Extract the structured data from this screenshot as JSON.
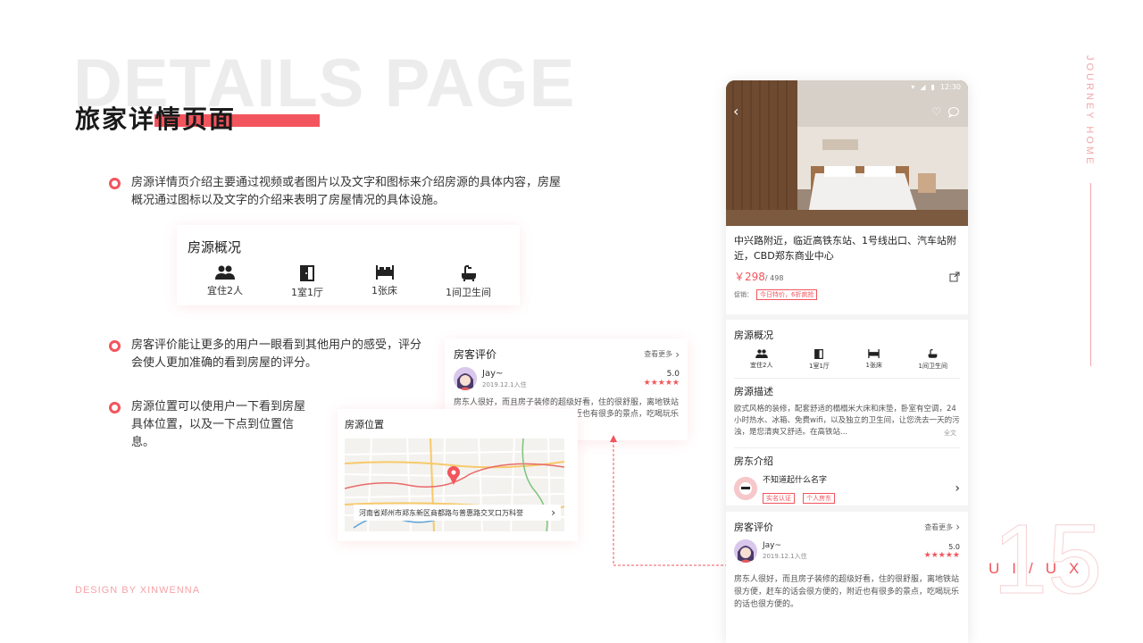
{
  "background_title": "DETAILS PAGE",
  "title": "旅家详情页面",
  "bullets": [
    {
      "text": "房源详情页介绍主要通过视频或者图片以及文字和图标来介绍房源的具体内容，房屋概况通过图标以及文字的介绍来表明了房屋情况的具体设施。"
    },
    {
      "text": "房客评价能让更多的用户一眼看到其他用户的感受，评分会使人更加准确的看到房屋的评分。"
    },
    {
      "text": "房源位置可以使用户一下看到房屋具体位置，以及一下点到位置信息。"
    }
  ],
  "overview_card": {
    "title": "房源概况",
    "features": [
      {
        "icon": "people-icon",
        "label": "宜住2人"
      },
      {
        "icon": "door-icon",
        "label": "1室1厅"
      },
      {
        "icon": "bed-icon",
        "label": "1张床"
      },
      {
        "icon": "bathtub-icon",
        "label": "1间卫生间"
      }
    ]
  },
  "review_card": {
    "title": "房客评价",
    "more": "查看更多",
    "user": "Jay~",
    "date": "2019.12.1入住",
    "score": "5.0",
    "stars": "★★★★★",
    "text": "房东人很好，而且房子装修的超级好看，住的很舒服，离地铁站很方便，赶车的话会很方便的，附近也有很多的景点，吃喝玩乐的话也很方便的。"
  },
  "location_card": {
    "title": "房源位置",
    "address": "河南省郑州市郑东新区商都路与普惠路交叉口万科誉"
  },
  "phone": {
    "status_time": "12:30",
    "listing_title": "中兴路附近，临近高铁东站、1号线出口、汽车站附近，CBD郑东商业中心",
    "price": "￥298",
    "original_price": "/ 498",
    "promo_label": "促销：",
    "promo_tag": "今日特价，6折疯抢",
    "overview_title": "房源概况",
    "features": [
      {
        "icon": "people-icon",
        "label": "宜住2人"
      },
      {
        "icon": "door-icon",
        "label": "1室1厅"
      },
      {
        "icon": "bed-icon",
        "label": "1张床"
      },
      {
        "icon": "bathtub-icon",
        "label": "1间卫生间"
      }
    ],
    "desc_title": "房源描述",
    "desc_text": "欧式风格的装修，配套舒适的榻榻米大床和床垫，卧室有空调，24小时热水、冰箱、免费wifi，以及独立的卫生间，让您洗去一天的污浊，是您清爽又舒适。在高铁站...",
    "desc_more": "全文",
    "host_title": "房东介绍",
    "host_name": "不知道起什么名字",
    "host_tags": [
      "实名认证",
      "个人房东"
    ],
    "review_title": "房客评价",
    "review_more": "查看更多",
    "review_user": "Jay~",
    "review_date": "2019.12.1入住",
    "review_score": "5.0",
    "review_stars": "★★★★★",
    "review_text": "房东人很好，而且房子装修的超级好看，住的很舒服，离地铁站很方便，赶车的话会很方便的，附近也有很多的景点，吃喝玩乐的话也很方便的。"
  },
  "side_text": "JOURNEY HOME",
  "page_number": "15",
  "uiux": "UI/UX",
  "footer": "DESIGN BY XINWENNA",
  "colors": {
    "accent": "#f2555d",
    "light_accent": "#f5a3a7",
    "bg_title": "#ececec"
  }
}
